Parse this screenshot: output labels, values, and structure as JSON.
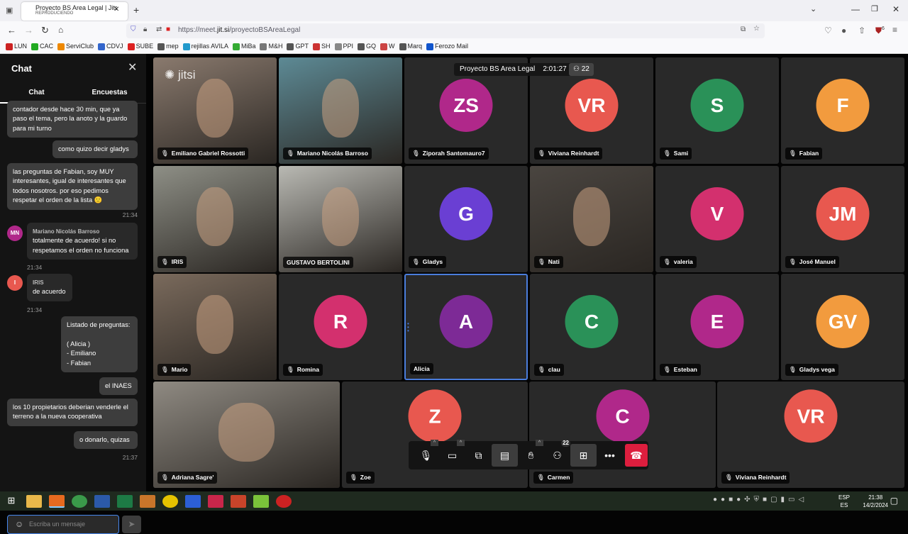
{
  "browser": {
    "tab_title": "Proyecto BS Area Legal | Jitsi Meet",
    "tab_status": "REPRODUCIENDO",
    "url_prefix": "https://meet.",
    "url_host": "jit.si",
    "url_path": "/proyectoBSAreaLegal",
    "extension_badge": "6",
    "bookmarks": [
      "LUN",
      "CAC",
      "ServiClub",
      "CDVJ",
      "SUBE",
      "mep",
      "rejillas AVILA",
      "MiBa",
      "M&H",
      "GPT",
      "SH",
      "PPI",
      "GQ",
      "W",
      "Marq",
      "Ferozo Mail"
    ]
  },
  "chat": {
    "title": "Chat",
    "tabs": [
      "Chat",
      "Encuestas"
    ],
    "messages": [
      {
        "text": "contador desde hace 30 min, que ya paso el tema, pero la anoto y la guardo para mi turno"
      },
      {
        "text": "como quizo decir gladys"
      },
      {
        "text": "las preguntas de Fabian, soy MUY interesantes, igual de interesantes que todos nosotros. por eso pedimos respetar el orden de la lista 🙂",
        "time": "21:34"
      },
      {
        "sender": "Mariano Nicolás Barroso",
        "initials": "MN",
        "text": "totalmente de acuerdo! si no respetamos el orden no funciona",
        "time": "21:34"
      },
      {
        "sender": "IRIS",
        "initials": "I",
        "text": "de acuerdo",
        "time": "21:34"
      },
      {
        "text": "Listado de preguntas:\n\n( Alicia )\n- Emiliano\n- Fabian"
      },
      {
        "text": "el INAES"
      },
      {
        "text": "los 10 propietarios deberian venderle el terreno a la nueva cooperativa"
      },
      {
        "text": "o donarlo, quizas",
        "time": "21:37"
      }
    ],
    "input_placeholder": "Escriba un mensaje"
  },
  "meeting": {
    "title": "Proyecto BS Area Legal",
    "duration": "2:01:27",
    "participant_count": "22",
    "logo": "jitsi"
  },
  "participants": [
    {
      "name": "Emiliano Gabriel Rossotti",
      "video": true,
      "bg": "#8a7a6e"
    },
    {
      "name": "Mariano Nicolás Barroso",
      "video": true,
      "bg": "#5d8a95"
    },
    {
      "name": "Ziporah Santomauro7",
      "initials": "ZS",
      "color": "#b0288a"
    },
    {
      "name": "Viviana Reinhardt",
      "initials": "VR",
      "color": "#e8584f"
    },
    {
      "name": "Sami",
      "initials": "S",
      "color": "#2a9158"
    },
    {
      "name": "Fabian",
      "initials": "F",
      "color": "#f29b3e"
    },
    {
      "name": "IRIS",
      "video": true,
      "bg": "#8e8f86"
    },
    {
      "name": "GUSTAVO BERTOLINI",
      "video": true,
      "bg": "#b9b9b3",
      "nomic": true
    },
    {
      "name": "Gladys",
      "initials": "G",
      "color": "#6a3fd3"
    },
    {
      "name": "Nati",
      "video": true,
      "bg": "#4a4540"
    },
    {
      "name": "valeria",
      "initials": "V",
      "color": "#d3306e"
    },
    {
      "name": "José Manuel",
      "initials": "JM",
      "color": "#e8584f"
    },
    {
      "name": "Mario",
      "video": true,
      "bg": "#7a6a5c"
    },
    {
      "name": "Romina",
      "initials": "R",
      "color": "#d3306e"
    },
    {
      "name": "Alicia",
      "initials": "A",
      "color": "#7d2a96",
      "active": true,
      "nomic": true
    },
    {
      "name": "clau",
      "initials": "C",
      "color": "#2a9158"
    },
    {
      "name": "Esteban",
      "initials": "E",
      "color": "#b0288a"
    },
    {
      "name": "Gladys vega",
      "initials": "GV",
      "color": "#f29b3e"
    },
    {
      "name": "Adriana Sagre'",
      "video": true,
      "bg": "#8f8a82"
    },
    {
      "name": "Zoe",
      "initials": "Z",
      "color": "#e8584f"
    },
    {
      "name": "Carmen",
      "initials": "C",
      "color": "#b0288a"
    },
    {
      "name": "Viviana Reinhardt",
      "initials": "VR",
      "color": "#e8584f"
    }
  ],
  "toolbar": {
    "items": [
      "microphone",
      "camera",
      "screen-share",
      "chat",
      "raise-hand",
      "participants",
      "tile-view",
      "more",
      "hang-up"
    ],
    "participants_badge": "22"
  },
  "taskbar": {
    "lang1": "ESP",
    "lang2": "ES",
    "time": "21:38",
    "date": "14/2/2024"
  }
}
